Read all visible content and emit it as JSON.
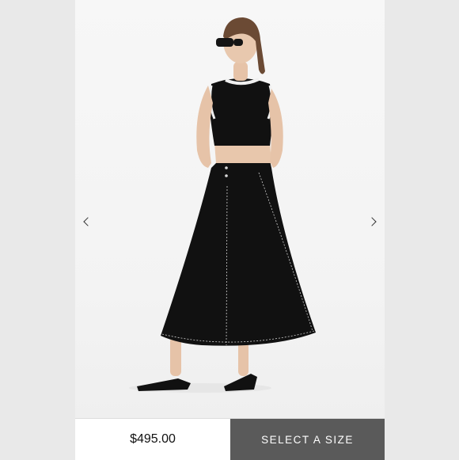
{
  "product": {
    "price": "$495.00"
  },
  "actions": {
    "select_size_label": "SELECT A SIZE"
  },
  "gallery": {
    "prev_icon": "chevron-left-icon",
    "next_icon": "chevron-right-icon"
  },
  "colors": {
    "cta_background": "#5a5a5a",
    "cta_text": "#ffffff",
    "page_background": "#e9e9e9"
  }
}
